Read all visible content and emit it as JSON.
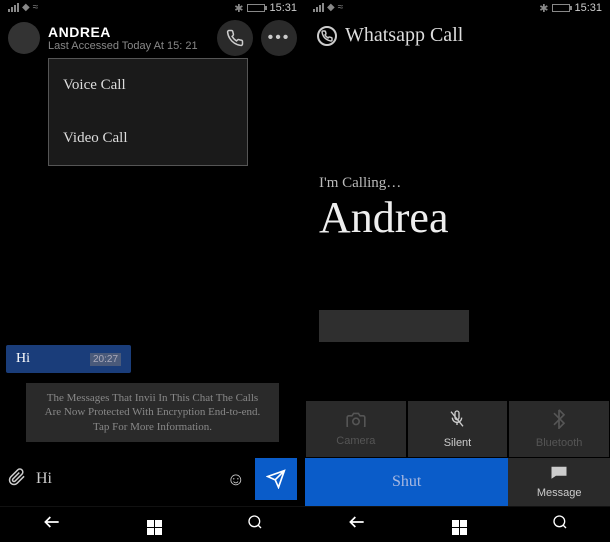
{
  "left": {
    "status": {
      "time": "15:31"
    },
    "header": {
      "name": "ANDREA",
      "last_seen": "Last Accessed Today At 15: 21"
    },
    "dropdown": {
      "voice_call": "Voice Call",
      "video_call": "Video Call"
    },
    "messages": {
      "hi": "Hi",
      "hi_time": "20:27",
      "encryption": "The Messages That Invii In This Chat The Calls Are Now Protected With Encryption End-to-end. Tap For More Information."
    },
    "input": {
      "text": "Hi"
    }
  },
  "right": {
    "status": {
      "time": "15:31"
    },
    "header": {
      "title": "Whatsapp Call"
    },
    "call": {
      "status": "I'm Calling…",
      "name": "Andrea"
    },
    "controls": {
      "camera": "Camera",
      "silent": "Silent",
      "bluetooth": "Bluetooth",
      "shut": "Shut",
      "message": "Message"
    }
  }
}
